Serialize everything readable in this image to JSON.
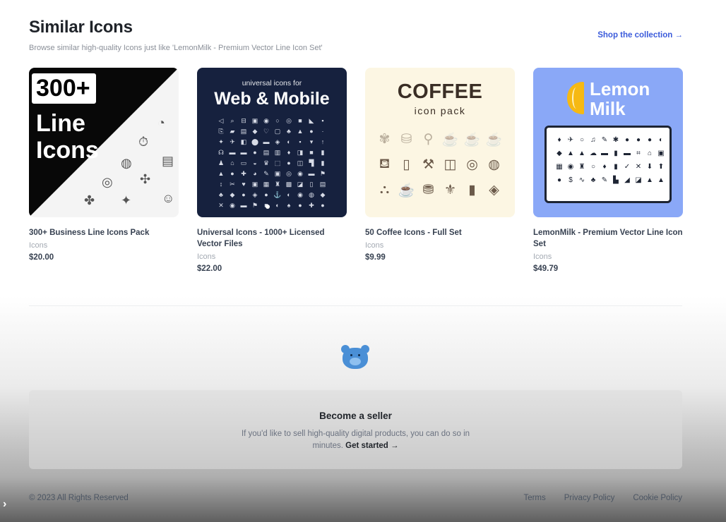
{
  "header": {
    "title": "Similar Icons",
    "subtitle": "Browse similar high-quality Icons just like 'LemonMilk - Premium Vector Line Icon Set'",
    "shop_link": "Shop the collection →"
  },
  "products": [
    {
      "title": "300+ Business Line Icons Pack",
      "category": "Icons",
      "price": "$20.00",
      "thumb": {
        "big_badge": "300+",
        "line1": "Line",
        "line2": "Icons"
      }
    },
    {
      "title": "Universal Icons - 1000+ Licensed Vector Files",
      "category": "Icons",
      "price": "$22.00",
      "thumb": {
        "small": "universal icons for",
        "large": "Web & Mobile"
      }
    },
    {
      "title": "50 Coffee Icons - Full Set",
      "category": "Icons",
      "price": "$9.99",
      "thumb": {
        "large": "COFFEE",
        "small": "icon pack"
      }
    },
    {
      "title": "LemonMilk - Premium Vector Line Icon Set",
      "category": "Icons",
      "price": "$49.79",
      "thumb": {
        "line1": "Lemon",
        "line2": "Milk"
      }
    }
  ],
  "seller": {
    "title": "Become a seller",
    "text": "If you'd like to sell high-quality digital products, you can do so in minutes.",
    "link": "Get started →"
  },
  "footer": {
    "copyright": "© 2023 All Rights Reserved",
    "links": [
      "Terms",
      "Privacy Policy",
      "Cookie Policy"
    ]
  },
  "icons": {
    "mascot": "bear-mascot-icon",
    "chevron": "chevron-right-icon"
  },
  "colors": {
    "link": "#3b5bdb",
    "lemon_bg": "#8aa8f7",
    "web_bg": "#16213e",
    "coffee_bg": "#fcf6e3",
    "mascot": "#4a8fd6"
  }
}
